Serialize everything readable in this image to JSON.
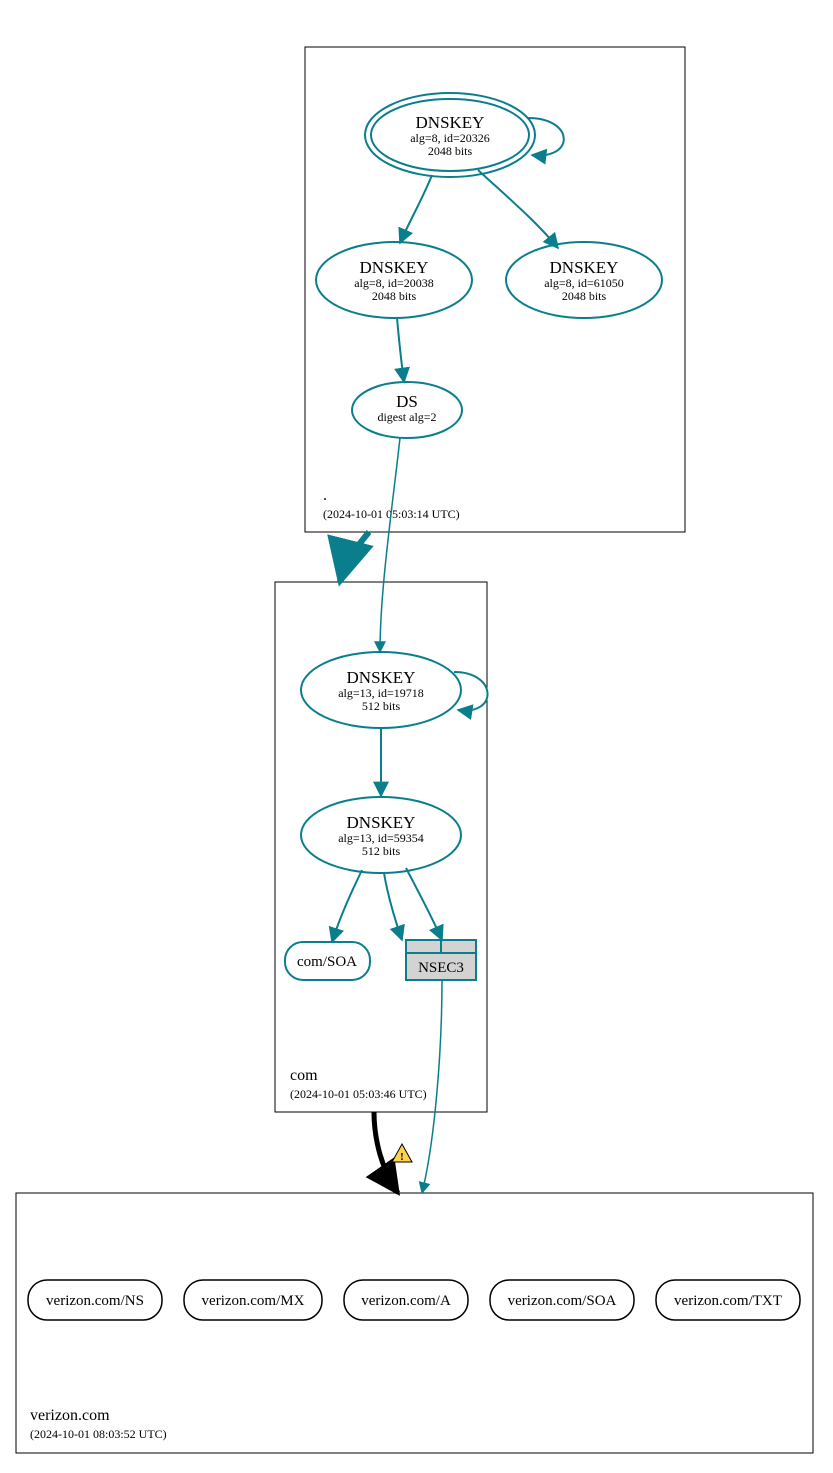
{
  "colors": {
    "teal": "#0a7e8c",
    "grey": "#d3d3d3"
  },
  "zones": {
    "root": {
      "label": ".",
      "time": "(2024-10-01 05:03:14 UTC)"
    },
    "com": {
      "label": "com",
      "time": "(2024-10-01 05:03:46 UTC)"
    },
    "leaf": {
      "label": "verizon.com",
      "time": "(2024-10-01 08:03:52 UTC)"
    }
  },
  "nodes": {
    "rootKSK": {
      "title": "DNSKEY",
      "line2": "alg=8, id=20326",
      "line3": "2048 bits"
    },
    "rootZSK1": {
      "title": "DNSKEY",
      "line2": "alg=8, id=20038",
      "line3": "2048 bits"
    },
    "rootZSK2": {
      "title": "DNSKEY",
      "line2": "alg=8, id=61050",
      "line3": "2048 bits"
    },
    "ds": {
      "title": "DS",
      "line2": "digest alg=2"
    },
    "comKSK": {
      "title": "DNSKEY",
      "line2": "alg=13, id=19718",
      "line3": "512 bits"
    },
    "comZSK": {
      "title": "DNSKEY",
      "line2": "alg=13, id=59354",
      "line3": "512 bits"
    },
    "comSOA": {
      "title": "com/SOA"
    },
    "nsec3": {
      "title": "NSEC3"
    }
  },
  "rr": {
    "ns": "verizon.com/NS",
    "mx": "verizon.com/MX",
    "a": "verizon.com/A",
    "soa": "verizon.com/SOA",
    "txt": "verizon.com/TXT"
  }
}
